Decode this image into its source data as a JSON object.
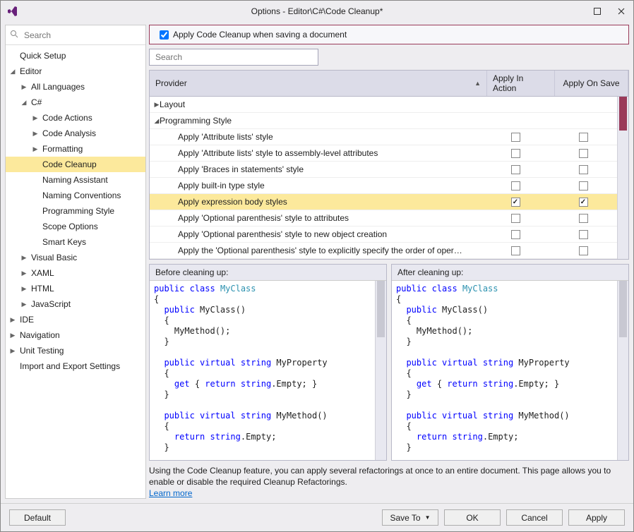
{
  "window": {
    "title": "Options - Editor\\C#\\Code Cleanup*"
  },
  "sidebar": {
    "search_placeholder": "Search",
    "items": [
      {
        "label": "Quick Setup",
        "expander": "",
        "indent": 0
      },
      {
        "label": "Editor",
        "expander": "◢",
        "indent": 0
      },
      {
        "label": "All Languages",
        "expander": "▶",
        "indent": 1
      },
      {
        "label": "C#",
        "expander": "◢",
        "indent": 1
      },
      {
        "label": "Code Actions",
        "expander": "▶",
        "indent": 2
      },
      {
        "label": "Code Analysis",
        "expander": "▶",
        "indent": 2
      },
      {
        "label": "Formatting",
        "expander": "▶",
        "indent": 2
      },
      {
        "label": "Code Cleanup",
        "expander": "",
        "indent": 2,
        "selected": true
      },
      {
        "label": "Naming Assistant",
        "expander": "",
        "indent": 2
      },
      {
        "label": "Naming Conventions",
        "expander": "",
        "indent": 2
      },
      {
        "label": "Programming Style",
        "expander": "",
        "indent": 2
      },
      {
        "label": "Scope Options",
        "expander": "",
        "indent": 2
      },
      {
        "label": "Smart Keys",
        "expander": "",
        "indent": 2
      },
      {
        "label": "Visual Basic",
        "expander": "▶",
        "indent": 1
      },
      {
        "label": "XAML",
        "expander": "▶",
        "indent": 1
      },
      {
        "label": "HTML",
        "expander": "▶",
        "indent": 1
      },
      {
        "label": "JavaScript",
        "expander": "▶",
        "indent": 1
      },
      {
        "label": "IDE",
        "expander": "▶",
        "indent": 0
      },
      {
        "label": "Navigation",
        "expander": "▶",
        "indent": 0
      },
      {
        "label": "Unit Testing",
        "expander": "▶",
        "indent": 0
      },
      {
        "label": "Import and Export Settings",
        "expander": "",
        "indent": 0
      }
    ]
  },
  "main": {
    "apply_on_save_checkbox": "Apply Code Cleanup when saving a document",
    "search_placeholder": "Search",
    "columns": {
      "provider": "Provider",
      "action": "Apply In Action",
      "save": "Apply On Save"
    },
    "groups": [
      {
        "label": "Layout",
        "expanded": false
      },
      {
        "label": "Programming Style",
        "expanded": true
      }
    ],
    "rows": [
      {
        "label": "Apply 'Attribute lists' style",
        "action": false,
        "save": false,
        "selected": false
      },
      {
        "label": "Apply 'Attribute lists' style to assembly-level attributes",
        "action": false,
        "save": false,
        "selected": false
      },
      {
        "label": "Apply 'Braces in statements' style",
        "action": false,
        "save": false,
        "selected": false
      },
      {
        "label": "Apply built-in type style",
        "action": false,
        "save": false,
        "selected": false
      },
      {
        "label": "Apply expression body styles",
        "action": true,
        "save": true,
        "selected": true
      },
      {
        "label": "Apply 'Optional parenthesis' style to attributes",
        "action": false,
        "save": false,
        "selected": false
      },
      {
        "label": "Apply 'Optional parenthesis' style to new object creation",
        "action": false,
        "save": false,
        "selected": false
      },
      {
        "label": "Apply the 'Optional parenthesis' style to explicitly specify the order of oper…",
        "action": false,
        "save": false,
        "selected": false
      }
    ],
    "before_label": "Before cleaning up:",
    "after_label": "After cleaning up:",
    "footer_desc": "Using the Code Cleanup feature, you can apply several refactorings at once to an entire document. This page allows you to enable or disable the required Cleanup Refactorings.",
    "learn_more": "Learn more"
  },
  "footer": {
    "default": "Default",
    "save_to": "Save To",
    "ok": "OK",
    "cancel": "Cancel",
    "apply": "Apply"
  },
  "code_before": [
    {
      "t": "public ",
      "cls": "kw"
    },
    {
      "t": "class ",
      "cls": "kw"
    },
    {
      "t": "MyClass",
      "cls": "type"
    },
    {
      "t": "\n"
    },
    {
      "t": "{\n"
    },
    {
      "t": "  "
    },
    {
      "t": "public ",
      "cls": "kw"
    },
    {
      "t": "MyClass()\n"
    },
    {
      "t": "  {\n"
    },
    {
      "t": "    MyMethod();\n"
    },
    {
      "t": "  }\n\n"
    },
    {
      "t": "  "
    },
    {
      "t": "public ",
      "cls": "kw"
    },
    {
      "t": "virtual ",
      "cls": "kw"
    },
    {
      "t": "string ",
      "cls": "kw"
    },
    {
      "t": "MyProperty\n"
    },
    {
      "t": "  {\n"
    },
    {
      "t": "    "
    },
    {
      "t": "get ",
      "cls": "kw"
    },
    {
      "t": "{ "
    },
    {
      "t": "return ",
      "cls": "kw"
    },
    {
      "t": "string",
      "cls": "kw"
    },
    {
      "t": ".Empty; }\n"
    },
    {
      "t": "  }\n\n"
    },
    {
      "t": "  "
    },
    {
      "t": "public ",
      "cls": "kw"
    },
    {
      "t": "virtual ",
      "cls": "kw"
    },
    {
      "t": "string ",
      "cls": "kw"
    },
    {
      "t": "MyMethod()\n"
    },
    {
      "t": "  {\n"
    },
    {
      "t": "    "
    },
    {
      "t": "return ",
      "cls": "kw"
    },
    {
      "t": "string",
      "cls": "kw"
    },
    {
      "t": ".Empty;\n"
    },
    {
      "t": "  }\n"
    }
  ],
  "code_after": [
    {
      "t": "public ",
      "cls": "kw"
    },
    {
      "t": "class ",
      "cls": "kw"
    },
    {
      "t": "MyClass",
      "cls": "type"
    },
    {
      "t": "\n"
    },
    {
      "t": "{\n"
    },
    {
      "t": "  "
    },
    {
      "t": "public ",
      "cls": "kw"
    },
    {
      "t": "MyClass()\n"
    },
    {
      "t": "  {\n"
    },
    {
      "t": "    MyMethod();\n"
    },
    {
      "t": "  }\n\n"
    },
    {
      "t": "  "
    },
    {
      "t": "public ",
      "cls": "kw"
    },
    {
      "t": "virtual ",
      "cls": "kw"
    },
    {
      "t": "string ",
      "cls": "kw"
    },
    {
      "t": "MyProperty\n"
    },
    {
      "t": "  {\n"
    },
    {
      "t": "    "
    },
    {
      "t": "get ",
      "cls": "kw"
    },
    {
      "t": "{ "
    },
    {
      "t": "return ",
      "cls": "kw"
    },
    {
      "t": "string",
      "cls": "kw"
    },
    {
      "t": ".Empty; }\n"
    },
    {
      "t": "  }\n\n"
    },
    {
      "t": "  "
    },
    {
      "t": "public ",
      "cls": "kw"
    },
    {
      "t": "virtual ",
      "cls": "kw"
    },
    {
      "t": "string ",
      "cls": "kw"
    },
    {
      "t": "MyMethod()\n"
    },
    {
      "t": "  {\n"
    },
    {
      "t": "    "
    },
    {
      "t": "return ",
      "cls": "kw"
    },
    {
      "t": "string",
      "cls": "kw"
    },
    {
      "t": ".Empty;\n"
    },
    {
      "t": "  }\n"
    }
  ]
}
